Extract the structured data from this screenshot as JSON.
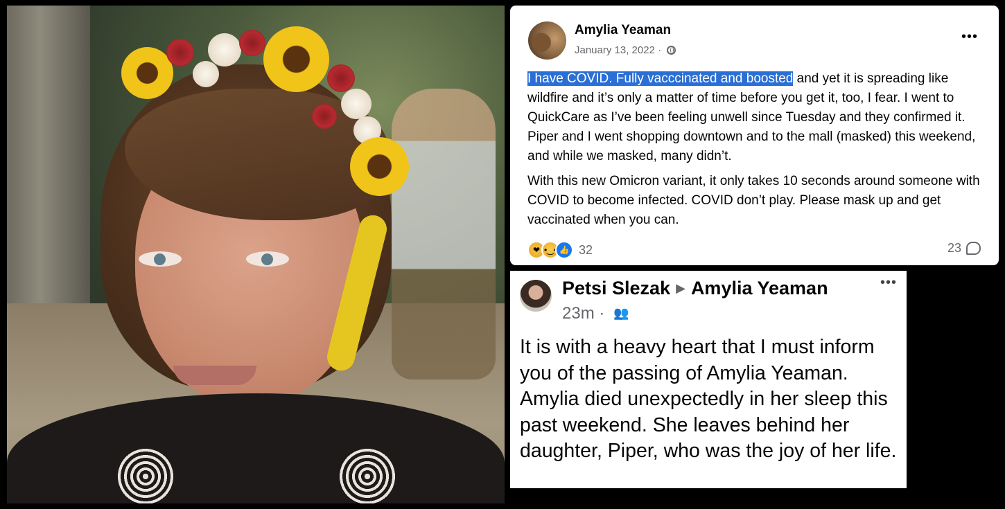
{
  "post_main": {
    "author": "Amylia Yeaman",
    "date": "January 13, 2022",
    "date_separator": "·",
    "privacy_icon": "globe-icon",
    "more_label": "•••",
    "highlighted_text": "I have COVID. Fully vacccinated and boosted",
    "paragraph1_rest": " and yet it is spreading like wildfire and it’s only a matter of time before you get it, too, I fear. I went to QuickCare as I’ve been feeling  unwell since Tuesday and they confirmed it. Piper and I went shopping downtown and to the mall (masked) this weekend, and while we masked, many didn’t.",
    "paragraph2": "With this new Omicron variant, it only takes 10 seconds around someone with COVID to become infected. COVID don’t play. Please mask up and get vaccinated when you can.",
    "reactions": [
      "care",
      "sad",
      "like"
    ],
    "reaction_count": "32",
    "comment_count": "23",
    "colors": {
      "highlight": "#2a6fd6",
      "like": "#1877f2",
      "secondary_text": "#65676b"
    }
  },
  "post_reply": {
    "author": "Petsi Slezak",
    "arrow": "▶",
    "target": "Amylia Yeaman",
    "time": "23m",
    "time_separator": "·",
    "audience_icon": "friends-icon",
    "more_label": "•••",
    "text": "It is with a heavy heart that I must inform you of the passing of Amylia Yeaman. Amylia died unexpectedly in her sleep this past weekend.  She leaves behind her daughter, Piper, who was the joy of her life."
  }
}
